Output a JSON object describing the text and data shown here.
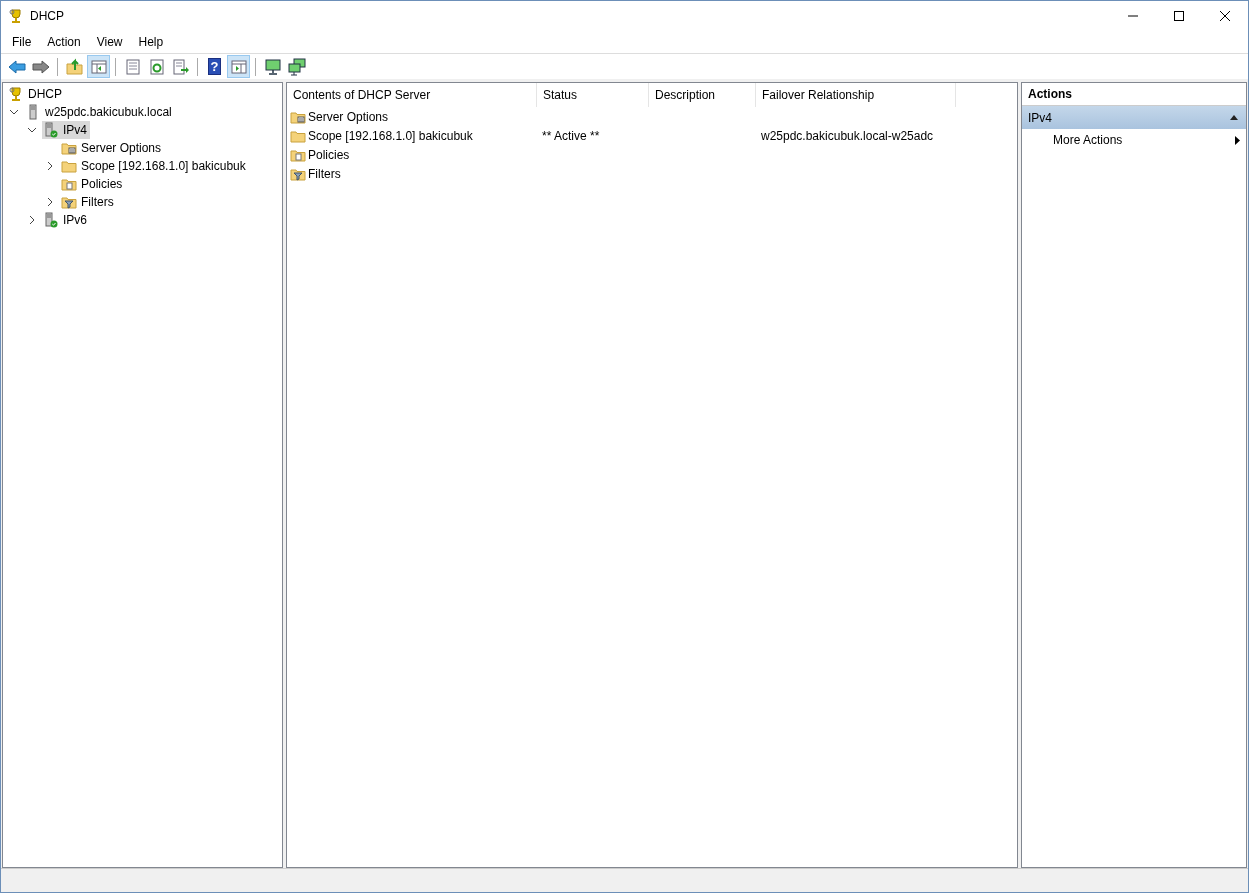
{
  "window": {
    "title": "DHCP"
  },
  "menu": [
    "File",
    "Action",
    "View",
    "Help"
  ],
  "toolbar": [
    {
      "kind": "button",
      "pressed": false
    },
    {
      "kind": "button",
      "pressed": false
    },
    {
      "kind": "separator"
    },
    {
      "kind": "button",
      "pressed": false
    },
    {
      "kind": "button",
      "pressed": true
    },
    {
      "kind": "separator"
    },
    {
      "kind": "button",
      "pressed": false
    },
    {
      "kind": "button",
      "pressed": false
    },
    {
      "kind": "button",
      "pressed": false
    },
    {
      "kind": "separator"
    },
    {
      "kind": "help",
      "label": "?",
      "pressed": false
    },
    {
      "kind": "button",
      "pressed": true
    },
    {
      "kind": "separator"
    },
    {
      "kind": "button",
      "pressed": false
    },
    {
      "kind": "button",
      "pressed": false
    }
  ],
  "tree": [
    {
      "label": "DHCP",
      "kind": "root",
      "selected": false,
      "children": [
        {
          "label": "w25pdc.bakicubuk.local",
          "kind": "server",
          "selected": false,
          "expanded": true,
          "children": [
            {
              "label": "IPv4",
              "kind": "protocol",
              "selected": true,
              "expanded": true,
              "children": [
                {
                  "label": "Server Options",
                  "kind": "options",
                  "selected": false
                },
                {
                  "label": "Scope [192.168.1.0] bakicubuk",
                  "kind": "scope",
                  "selected": false,
                  "expanded": false
                },
                {
                  "label": "Policies",
                  "kind": "policies",
                  "selected": false
                },
                {
                  "label": "Filters",
                  "kind": "filters",
                  "selected": false,
                  "expanded": false
                }
              ]
            },
            {
              "label": "IPv6",
              "kind": "protocol",
              "selected": false,
              "expanded": false
            }
          ]
        }
      ]
    }
  ],
  "table": {
    "columns": [
      "Contents of DHCP Server",
      "Status",
      "Description",
      "Failover Relationship"
    ],
    "rows": [
      {
        "kind": "options",
        "cells": [
          "Server Options",
          "",
          "",
          ""
        ]
      },
      {
        "kind": "scope",
        "cells": [
          "Scope [192.168.1.0] bakicubuk",
          "** Active **",
          "",
          "w25pdc.bakicubuk.local-w25adc"
        ]
      },
      {
        "kind": "policies",
        "cells": [
          "Policies",
          "",
          "",
          ""
        ]
      },
      {
        "kind": "filters",
        "cells": [
          "Filters",
          "",
          "",
          ""
        ]
      }
    ]
  },
  "actions": {
    "title": "Actions",
    "sections": [
      {
        "title": "IPv4",
        "expanded": true,
        "items": [
          {
            "label": "More Actions",
            "submenu": true
          }
        ]
      }
    ]
  }
}
